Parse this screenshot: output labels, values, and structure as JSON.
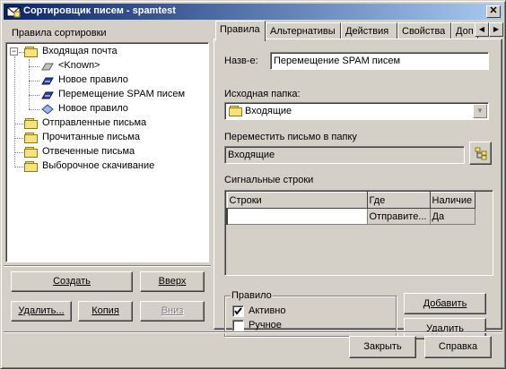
{
  "window": {
    "title": "Сортировщик писем - spamtest",
    "close_glyph": "✕"
  },
  "left": {
    "label": "Правила сортировки",
    "tree": [
      {
        "label": "Входящая почта",
        "icon": "folder-icon",
        "level": 0,
        "expanded": true
      },
      {
        "label": "<Known>",
        "icon": "rule-icon-gray",
        "level": 1
      },
      {
        "label": "Новое правило",
        "icon": "rule-icon-blue",
        "level": 1
      },
      {
        "label": "Перемещение SPAM писем",
        "icon": "rule-icon-blue",
        "level": 1
      },
      {
        "label": "Новое правило",
        "icon": "rule-icon-diamond",
        "level": 1
      },
      {
        "label": "Отправленные письма",
        "icon": "folder-icon",
        "level": 0
      },
      {
        "label": "Прочитанные письма",
        "icon": "folder-icon",
        "level": 0
      },
      {
        "label": "Отвеченные письма",
        "icon": "folder-icon",
        "level": 0
      },
      {
        "label": "Выборочное скачивание",
        "icon": "folder-icon",
        "level": 0
      }
    ],
    "buttons": {
      "create": "Создать",
      "up": "Вверх",
      "delete": "Удалить...",
      "copy": "Копия",
      "down": "Вниз"
    }
  },
  "tabs": [
    "Правила",
    "Альтернативы",
    "Действия",
    "Свойства",
    "Доп"
  ],
  "rules_tab": {
    "name_label": "Назв-е:",
    "name_value": "Перемещение SPAM писем",
    "source_label": "Исходная папка:",
    "source_value": "Входящие",
    "move_label": "Переместить письмо в папку",
    "move_value": "Входящие",
    "signal_label": "Сигнальные строки",
    "table": {
      "headers": [
        "Строки",
        "Где",
        "Наличие"
      ],
      "rows": [
        [
          "",
          "Отправите...",
          "Да"
        ]
      ]
    },
    "rule_group": "Правило",
    "active_label": "Активно",
    "active_checked": true,
    "manual_label": "Ручное",
    "manual_checked": false,
    "add_button": "Добавить",
    "delete_button": "Удалить"
  },
  "footer": {
    "close_button": "Закрыть",
    "help_button": "Справка"
  }
}
